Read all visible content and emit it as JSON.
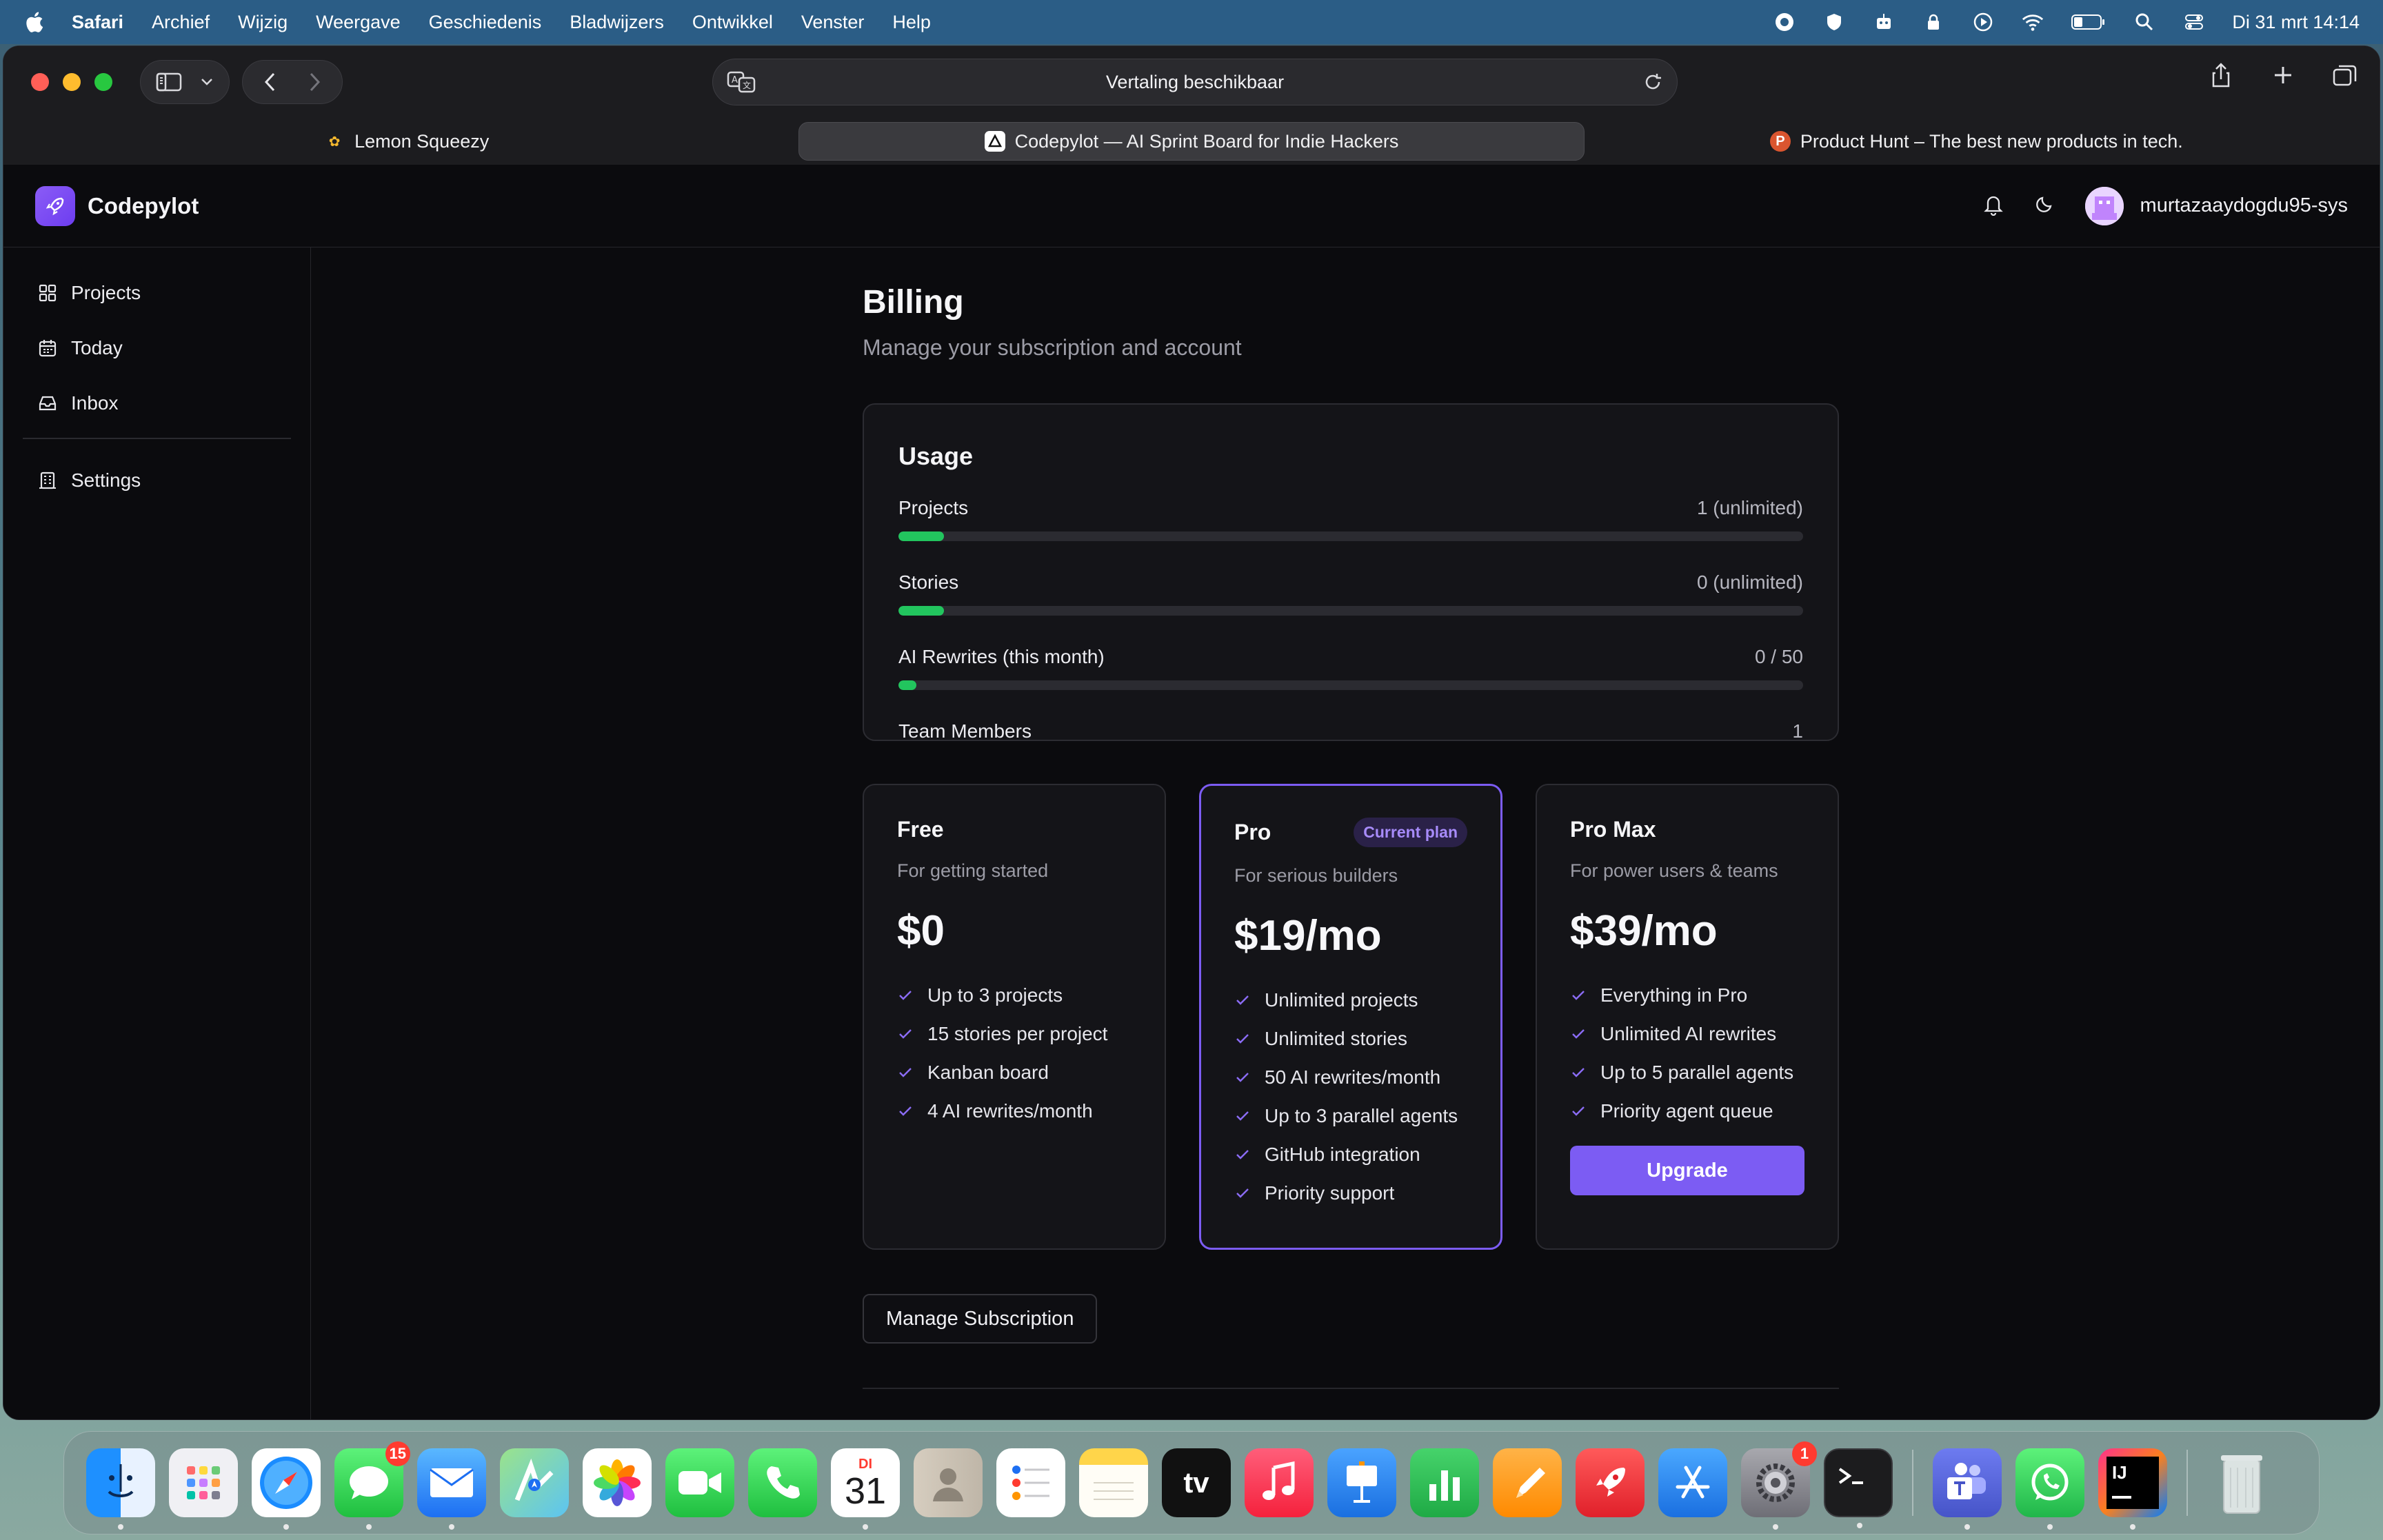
{
  "menubar": {
    "app_name": "Safari",
    "items": [
      "Archief",
      "Wijzig",
      "Weergave",
      "Geschiedenis",
      "Bladwijzers",
      "Ontwikkel",
      "Venster",
      "Help"
    ],
    "clock": "Di 31 mrt  14:14",
    "status_icons": [
      "record-icon",
      "vpn-icon",
      "robot-icon",
      "lock-icon",
      "play-icon",
      "wifi-icon",
      "battery-icon",
      "spotlight-icon",
      "control-center-icon"
    ]
  },
  "browser": {
    "url_text": "Vertaling beschikbaar",
    "tabs": [
      {
        "label": "Lemon Squeezy",
        "active": false
      },
      {
        "label": "Codepylot — AI Sprint Board for Indie Hackers",
        "active": true
      },
      {
        "label": "Product Hunt – The best new products in tech.",
        "active": false
      }
    ]
  },
  "app": {
    "brand": "Codepylot",
    "username": "murtazaaydogdu95-sys",
    "accent_color": "#7c5cf3",
    "sidebar": {
      "items": [
        {
          "label": "Projects",
          "icon": "grid-icon"
        },
        {
          "label": "Today",
          "icon": "calendar-icon"
        },
        {
          "label": "Inbox",
          "icon": "inbox-icon"
        }
      ],
      "settings_label": "Settings"
    }
  },
  "billing": {
    "title": "Billing",
    "subtitle": "Manage your subscription and account",
    "usage": {
      "heading": "Usage",
      "rows": [
        {
          "label": "Projects",
          "value": "1 (unlimited)",
          "fill_fraction": 0.05
        },
        {
          "label": "Stories",
          "value": "0 (unlimited)",
          "fill_fraction": 0.05
        },
        {
          "label": "AI Rewrites (this month)",
          "value": "0 / 50",
          "fill_fraction": 0.02
        }
      ],
      "team_label": "Team Members",
      "team_value": "1",
      "bar_color": "#22c55e"
    },
    "plans": [
      {
        "name": "Free",
        "description": "For getting started",
        "price": "$0",
        "features": [
          "Up to 3 projects",
          "15 stories per project",
          "Kanban board",
          "4 AI rewrites/month"
        ]
      },
      {
        "name": "Pro",
        "badge": "Current plan",
        "description": "For serious builders",
        "price": "$19/mo",
        "features": [
          "Unlimited projects",
          "Unlimited stories",
          "50 AI rewrites/month",
          "Up to 3 parallel agents",
          "GitHub integration",
          "Priority support"
        ]
      },
      {
        "name": "Pro Max",
        "description": "For power users & teams",
        "price": "$39/mo",
        "features": [
          "Everything in Pro",
          "Unlimited AI rewrites",
          "Up to 5 parallel agents",
          "Priority agent queue"
        ],
        "button": "Upgrade"
      }
    ],
    "manage_button": "Manage Subscription"
  },
  "dock": {
    "apps": [
      {
        "name": "finder-icon"
      },
      {
        "name": "launchpad-icon"
      },
      {
        "name": "safari-icon"
      },
      {
        "name": "messages-icon",
        "badge": "15"
      },
      {
        "name": "mail-icon"
      },
      {
        "name": "maps-icon"
      },
      {
        "name": "photos-icon"
      },
      {
        "name": "facetime-icon"
      },
      {
        "name": "phone-icon"
      },
      {
        "name": "calendar-icon",
        "month": "DI",
        "day": "31"
      },
      {
        "name": "contacts-icon"
      },
      {
        "name": "reminders-icon"
      },
      {
        "name": "notes-icon"
      },
      {
        "name": "apple-tv-icon",
        "label": "tv"
      },
      {
        "name": "music-icon"
      },
      {
        "name": "keynote-icon"
      },
      {
        "name": "numbers-icon"
      },
      {
        "name": "pages-icon"
      },
      {
        "name": "rocket-icon"
      },
      {
        "name": "app-store-icon"
      },
      {
        "name": "system-settings-icon",
        "badge": "1"
      },
      {
        "name": "terminal-icon"
      },
      {
        "name": "teams-icon"
      },
      {
        "name": "whatsapp-icon"
      },
      {
        "name": "intellij-icon",
        "label": "IJ"
      },
      {
        "name": "trash-icon"
      }
    ]
  }
}
